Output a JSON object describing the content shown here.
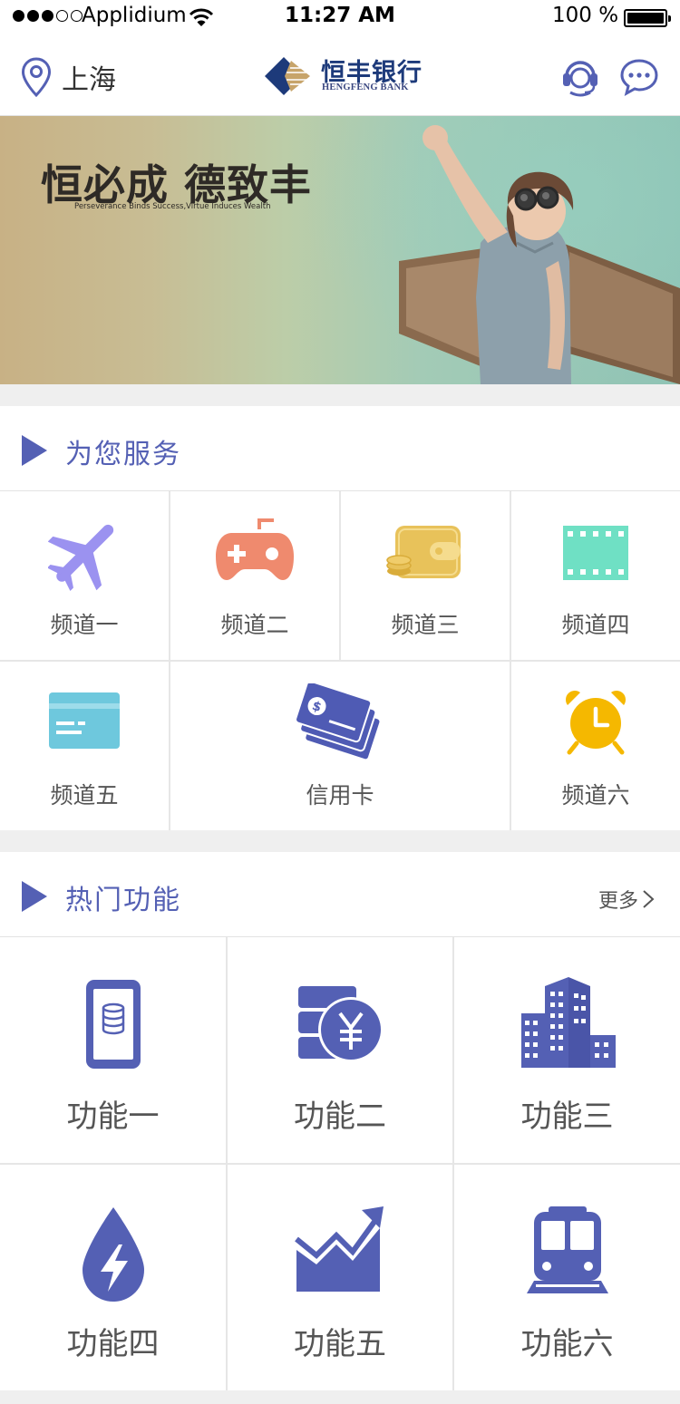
{
  "status_bar": {
    "carrier": "Applidium",
    "time": "11:27 AM",
    "battery": "100 %"
  },
  "nav": {
    "location": "上海",
    "logo_cn": "恒丰银行",
    "logo_en": "HENGFENG BANK",
    "icons": {
      "location": "location-pin-icon",
      "service": "customer-service-icon",
      "message": "chat-bubble-icon"
    }
  },
  "banner": {
    "title": "恒必成 德致丰",
    "subtitle": "Perseverance Binds Success,Virtue Induces Wealth",
    "slide_count": 5,
    "active_slide": 3
  },
  "services": {
    "title": "为您服务",
    "items": [
      {
        "label": "频道一",
        "icon": "airplane-icon",
        "color": "#9b92f0"
      },
      {
        "label": "频道二",
        "icon": "gamepad-icon",
        "color": "#ef8a6e"
      },
      {
        "label": "频道三",
        "icon": "wallet-icon",
        "color": "#e8c25a"
      },
      {
        "label": "频道四",
        "icon": "film-icon",
        "color": "#6fe0c4"
      },
      {
        "label": "频道五",
        "icon": "card-icon",
        "color": "#6ec8dd"
      },
      {
        "label": "信用卡",
        "icon": "credit-cards-icon",
        "color": "#4f5bb4"
      },
      {
        "label": "频道六",
        "icon": "alarm-clock-icon",
        "color": "#f5b800"
      }
    ]
  },
  "hot": {
    "title": "热门功能",
    "more": "更多",
    "items": [
      {
        "label": "功能一",
        "icon": "phone-database-icon"
      },
      {
        "label": "功能二",
        "icon": "yuan-coins-icon"
      },
      {
        "label": "功能三",
        "icon": "buildings-icon"
      },
      {
        "label": "功能四",
        "icon": "energy-drop-icon"
      },
      {
        "label": "功能五",
        "icon": "trend-chart-icon"
      },
      {
        "label": "功能六",
        "icon": "train-icon"
      }
    ],
    "icon_color": "#5460b4"
  }
}
